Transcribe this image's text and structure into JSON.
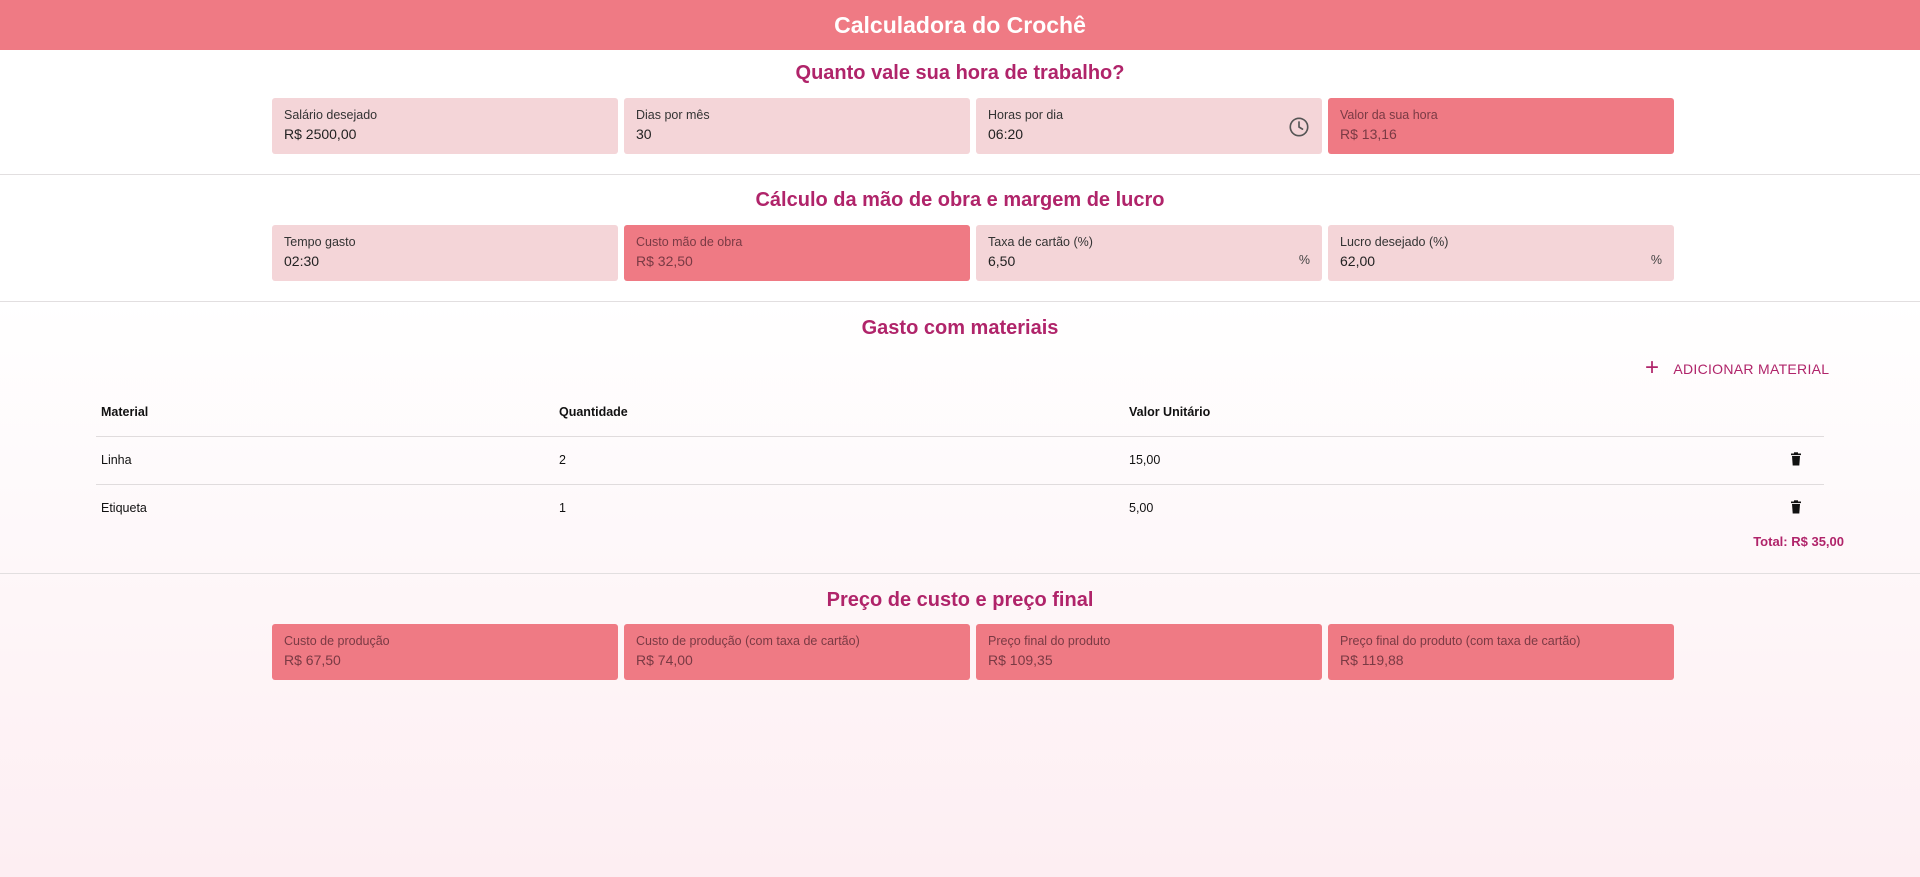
{
  "app": {
    "title": "Calculadora do Crochê"
  },
  "hourly": {
    "title": "Quanto vale sua hora de trabalho?",
    "fields": [
      {
        "label": "Salário desejado",
        "value": "R$ 2500,00"
      },
      {
        "label": "Dias por mês",
        "value": "30"
      },
      {
        "label": "Horas por dia",
        "value": "06:20",
        "icon": "clock-icon"
      },
      {
        "label": "Valor da sua hora",
        "value": "R$ 13,16"
      }
    ]
  },
  "labor": {
    "title": "Cálculo da mão de obra e margem de lucro",
    "fields": [
      {
        "label": "Tempo gasto",
        "value": "02:30"
      },
      {
        "label": "Custo mão de obra",
        "value": "R$ 32,50"
      },
      {
        "label": "Taxa de cartão (%)",
        "value": "6,50",
        "suffix": "%"
      },
      {
        "label": "Lucro desejado (%)",
        "value": "62,00",
        "suffix": "%"
      }
    ]
  },
  "materials": {
    "title": "Gasto com materiais",
    "add_label": "ADICIONAR MATERIAL",
    "columns": [
      "Material",
      "Quantidade",
      "Valor Unitário"
    ],
    "rows": [
      {
        "material": "Linha",
        "quantity": "2",
        "unit_value": "15,00"
      },
      {
        "material": "Etiqueta",
        "quantity": "1",
        "unit_value": "5,00"
      }
    ],
    "total": "Total: R$ 35,00"
  },
  "final": {
    "title": "Preço de custo e preço final",
    "fields": [
      {
        "label": "Custo de produção",
        "value": "R$ 67,50"
      },
      {
        "label": "Custo de produção (com taxa de cartão)",
        "value": "R$ 74,00"
      },
      {
        "label": "Preço final do produto",
        "value": "R$ 109,35"
      },
      {
        "label": "Preço final do produto (com taxa de cartão)",
        "value": "R$ 119,88"
      }
    ]
  },
  "colors": {
    "appbar": "#ef7a84",
    "accent_text": "#b0246a",
    "input_bg": "#f4d5d8",
    "computed_bg": "#ef7a84"
  }
}
